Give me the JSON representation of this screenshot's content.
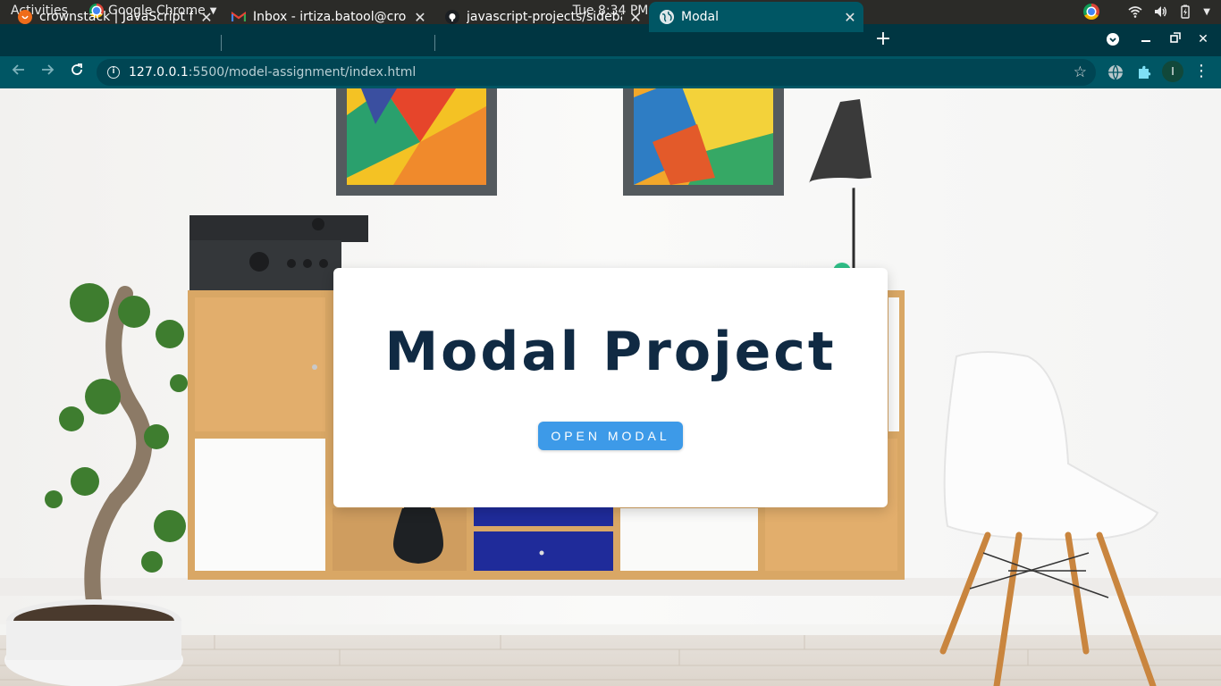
{
  "system_bar": {
    "activities": "Activities",
    "app_name": "Google Chrome",
    "clock": "Tue  8:34 PM"
  },
  "tabs": [
    {
      "title": "crownstack | JavaScript fo",
      "icon": "crownstack-icon",
      "active": false
    },
    {
      "title": "Inbox - irtiza.batool@crow",
      "icon": "gmail-icon",
      "active": false
    },
    {
      "title": "javascript-projects/sideba",
      "icon": "github-icon",
      "active": false
    },
    {
      "title": "Modal",
      "icon": "globe-icon",
      "active": true
    }
  ],
  "address_bar": {
    "url_host": "127.0.0.1",
    "url_rest": ":5500/model-assignment/index.html"
  },
  "profile": {
    "initial": "I"
  },
  "page": {
    "title": "Modal Project",
    "open_button_label": "OPEN MODAL"
  },
  "colors": {
    "title_color": "#102a43",
    "button_color": "#3d9ae8",
    "tab_strip": "#003642",
    "toolbar": "#005664"
  }
}
